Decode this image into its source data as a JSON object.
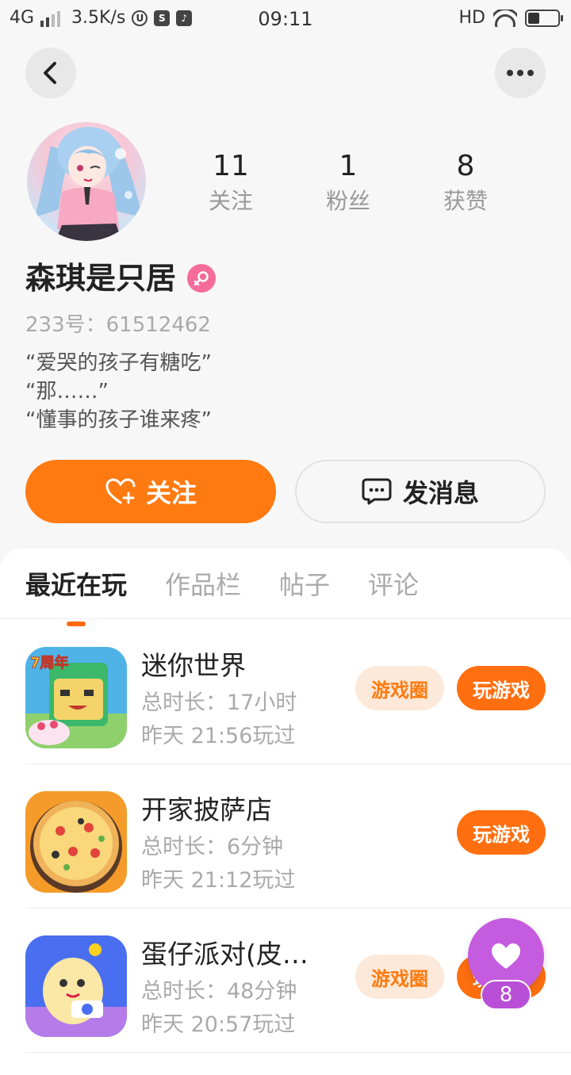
{
  "status_bar": {
    "network": "4G",
    "speed": "3.5K/s",
    "time": "09:11",
    "hd": "HD"
  },
  "profile": {
    "stats": [
      {
        "value": "11",
        "label": "关注"
      },
      {
        "value": "1",
        "label": "粉丝"
      },
      {
        "value": "8",
        "label": "获赞"
      }
    ],
    "name": "森琪是只居",
    "gender_icon": "female-icon",
    "uid": "233号：61512462",
    "bio": [
      "“爱哭的孩子有糖吃”",
      "“那……”",
      "“懂事的孩子谁来疼”"
    ],
    "follow_label": "关注",
    "message_label": "发消息"
  },
  "tabs": [
    {
      "label": "最近在玩",
      "active": true
    },
    {
      "label": "作品栏",
      "active": false
    },
    {
      "label": "帖子",
      "active": false
    },
    {
      "label": "评论",
      "active": false
    }
  ],
  "games": [
    {
      "name": "迷你世界",
      "duration": "总时长：17小时",
      "last_played": "昨天 21:56玩过",
      "circle_label": "游戏圈",
      "play_label": "玩游戏"
    },
    {
      "name": "开家披萨店",
      "duration": "总时长：6分钟",
      "last_played": "昨天 21:12玩过",
      "circle_label": "",
      "play_label": "玩游戏"
    },
    {
      "name": "蛋仔派对(皮…",
      "duration": "总时长：48分钟",
      "last_played": "昨天 20:57玩过",
      "circle_label": "游戏圈",
      "play_label": "玩游戏"
    }
  ],
  "floating_like": {
    "count": "8"
  },
  "colors": {
    "accent": "#ff7a10",
    "like_purple": "#c55ce0",
    "gender_pink": "#f56c9a"
  }
}
